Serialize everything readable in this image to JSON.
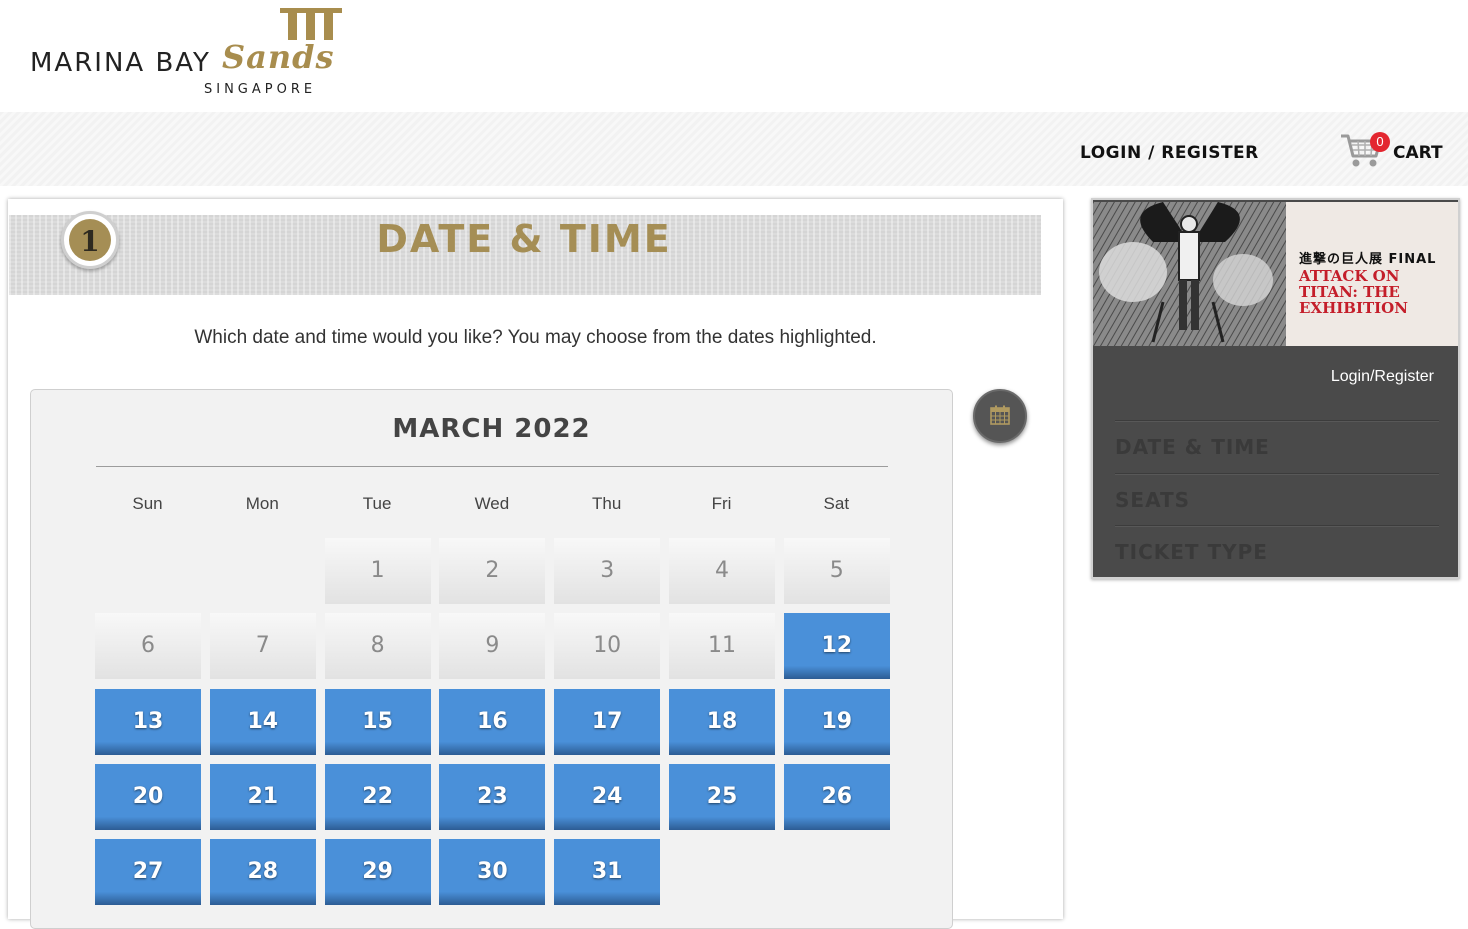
{
  "brand": {
    "logo_main": "MARINA BAY",
    "logo_script": "Sands",
    "logo_sub": "SINGAPORE"
  },
  "nav": {
    "login": "LOGIN / REGISTER",
    "cart_count": "0",
    "cart_label": "CART"
  },
  "step": {
    "number": "1",
    "title": "DATE & TIME"
  },
  "instructions": "Which date and time would you like? You may choose from the dates highlighted.",
  "calendar": {
    "month_label": "MARCH 2022",
    "weekdays": [
      "Sun",
      "Mon",
      "Tue",
      "Wed",
      "Thu",
      "Fri",
      "Sat"
    ],
    "first_weekday_index": 2,
    "days": [
      {
        "d": "1",
        "available": false
      },
      {
        "d": "2",
        "available": false
      },
      {
        "d": "3",
        "available": false
      },
      {
        "d": "4",
        "available": false
      },
      {
        "d": "5",
        "available": false
      },
      {
        "d": "6",
        "available": false
      },
      {
        "d": "7",
        "available": false
      },
      {
        "d": "8",
        "available": false
      },
      {
        "d": "9",
        "available": false
      },
      {
        "d": "10",
        "available": false
      },
      {
        "d": "11",
        "available": false
      },
      {
        "d": "12",
        "available": true
      },
      {
        "d": "13",
        "available": true
      },
      {
        "d": "14",
        "available": true
      },
      {
        "d": "15",
        "available": true
      },
      {
        "d": "16",
        "available": true
      },
      {
        "d": "17",
        "available": true
      },
      {
        "d": "18",
        "available": true
      },
      {
        "d": "19",
        "available": true
      },
      {
        "d": "20",
        "available": true
      },
      {
        "d": "21",
        "available": true
      },
      {
        "d": "22",
        "available": true
      },
      {
        "d": "23",
        "available": true
      },
      {
        "d": "24",
        "available": true
      },
      {
        "d": "25",
        "available": true
      },
      {
        "d": "26",
        "available": true
      },
      {
        "d": "27",
        "available": true
      },
      {
        "d": "28",
        "available": true
      },
      {
        "d": "29",
        "available": true
      },
      {
        "d": "30",
        "available": true
      },
      {
        "d": "31",
        "available": true
      }
    ],
    "colors": {
      "available": "#4a90d9",
      "unavailable": "#e8e8e8"
    }
  },
  "calendar_button_icon": "calendar-icon",
  "sidebar": {
    "banner_jp": "進撃の巨人展 FINAL",
    "banner_title": "ATTACK ON TITAN: THE EXHIBITION",
    "login": "Login/Register",
    "steps": [
      "DATE & TIME",
      "SEATS",
      "TICKET TYPE"
    ]
  }
}
